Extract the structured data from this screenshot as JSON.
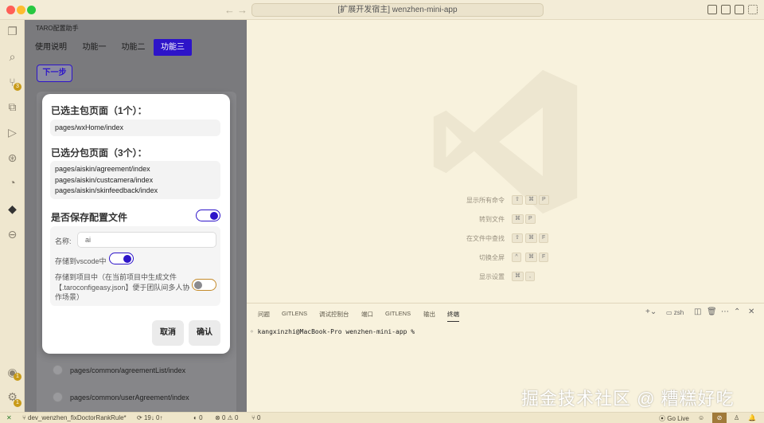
{
  "window": {
    "title": "[扩展开发宿主] wenzhen-mini-app",
    "traffic_colors": [
      "#ff5f57",
      "#febc2e",
      "#28c840"
    ]
  },
  "activity_bar": {
    "icons": [
      "files-icon",
      "search-icon",
      "source-control-icon",
      "extensions-icon",
      "run-debug-icon",
      "git-graph-icon",
      "remote-icon",
      "taro-icon",
      "timeline-icon"
    ],
    "scm_badge": "3",
    "account_badge": "1",
    "settings_badge": "1"
  },
  "taro_panel": {
    "title": "TARO配置助手",
    "tabs": [
      "使用说明",
      "功能一",
      "功能二",
      "功能三"
    ],
    "active_tab": 3,
    "next_button": "下一步",
    "background_rows": [
      "pages/common/agreementList/index",
      "pages/common/userAgreement/index"
    ]
  },
  "modal": {
    "main_heading": "已选主包页面（1个）：",
    "main_pages": [
      "pages/wxHome/index"
    ],
    "sub_heading": "已选分包页面（3个）：",
    "sub_pages": [
      "pages/aiskin/agreement/index",
      "pages/aiskin/custcamera/index",
      "pages/aiskin/skinfeedback/index"
    ],
    "save_label": "是否保存配置文件",
    "save_enabled": true,
    "name_label": "名称:",
    "name_value": "ai",
    "vscode_label": "存储到vscode中",
    "vscode_enabled": true,
    "project_label": "存储到项目中（在当前项目中生成文件【.taroconfigeasy.json】便于团队间多人协作场景）",
    "project_enabled": false,
    "cancel": "取消",
    "confirm": "确认",
    "accent": "#2d14c9"
  },
  "editor": {
    "shortcuts": [
      {
        "label": "显示所有命令",
        "keys": [
          "⇧",
          "⌘",
          "P"
        ]
      },
      {
        "label": "转到文件",
        "keys": [
          "⌘",
          "P"
        ]
      },
      {
        "label": "在文件中查找",
        "keys": [
          "⇧",
          "⌘",
          "F"
        ]
      },
      {
        "label": "切换全屏",
        "keys": [
          "^",
          "⌘",
          "F"
        ]
      },
      {
        "label": "显示设置",
        "keys": [
          "⌘",
          ","
        ]
      }
    ]
  },
  "terminal": {
    "tabs": [
      "问题",
      "GITLENS",
      "调试控制台",
      "端口",
      "GITLENS",
      "输出",
      "终端"
    ],
    "active_tab": 6,
    "shell": "zsh",
    "prompt": "kangxinzhi@MacBook-Pro wenzhen-mini-app %"
  },
  "watermark": "掘金技术社区 @ 糟糕好吃",
  "statusbar": {
    "branch": "dev_wenzhen_fixDoctorRankRule*",
    "sync": "19↓ 0↑",
    "icon_count": "0",
    "errors": "0",
    "warnings": "0",
    "ports": "0",
    "golive": "Go Live"
  }
}
